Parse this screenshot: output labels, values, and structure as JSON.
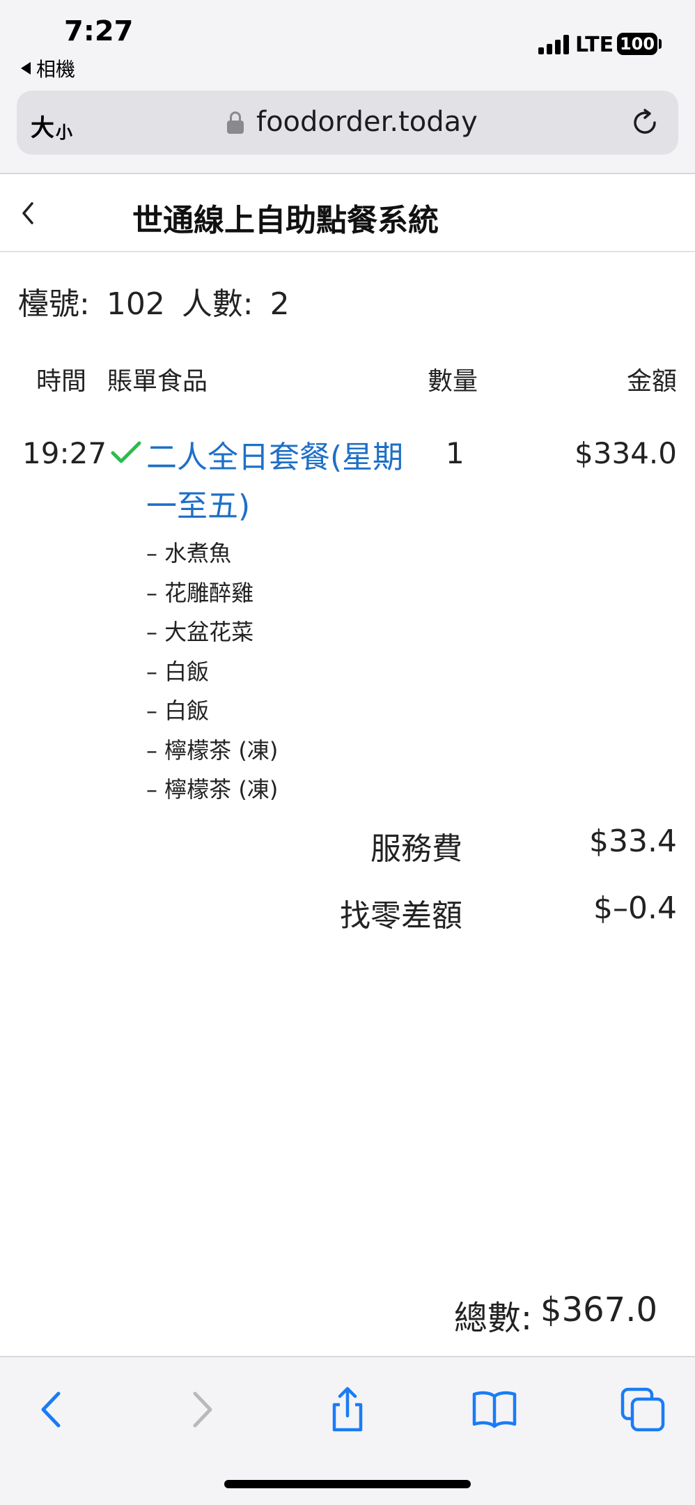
{
  "status_bar": {
    "time": "7:27",
    "back_app": "相機",
    "network": "LTE",
    "battery": "100"
  },
  "browser": {
    "text_size": "大",
    "text_size_small": "小",
    "url": "foodorder.today"
  },
  "page": {
    "title": "世通線上自助點餐系統",
    "table_label": "檯號:",
    "table_no": "102",
    "guests_label": "人數:",
    "guests": "2"
  },
  "columns": {
    "time": "時間",
    "item": "賬單食品",
    "qty": "數量",
    "amount": "金額"
  },
  "order": {
    "time": "19:27",
    "name": "二人全日套餐(星期一至五)",
    "qty": "1",
    "amount": "$334.0",
    "sub_items": [
      "– 水煮魚",
      "– 花雕醉雞",
      "– 大盆花菜",
      "– 白飯",
      "– 白飯",
      "– 檸檬茶 (凍)",
      "– 檸檬茶 (凍)"
    ]
  },
  "fees": {
    "service_label": "服務費",
    "service_value": "$33.4",
    "rounding_label": "找零差額",
    "rounding_value": "$–0.4"
  },
  "total": {
    "label": "總數:",
    "value": "$367.0"
  },
  "colors": {
    "link_blue": "#1e6fc7",
    "check_green": "#2dbb4e",
    "toolbar_blue": "#1a7cf5"
  }
}
